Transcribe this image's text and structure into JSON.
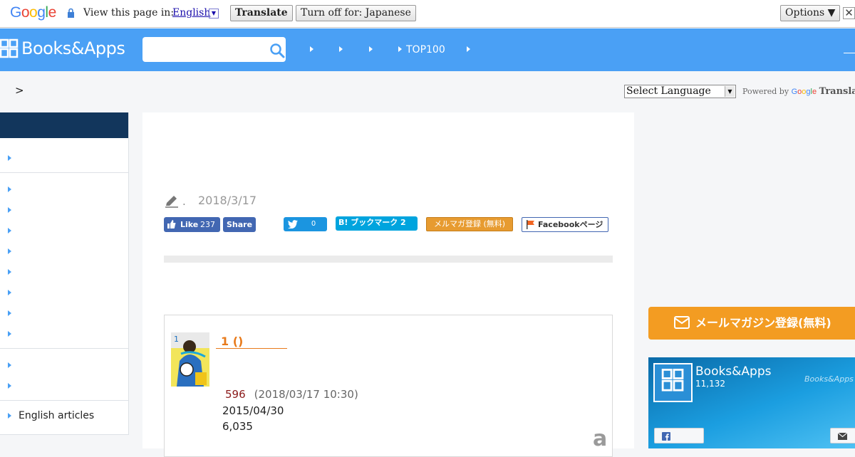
{
  "translate_bar": {
    "logo": "Google",
    "view_label": "View this page in:",
    "language": "English",
    "translate_btn": "Translate",
    "turn_off_btn": "Turn off for: Japanese",
    "options_btn": "Options ▼",
    "close": "✕"
  },
  "header": {
    "logo_text": "Books&Apps",
    "nav": [
      "",
      "",
      "",
      "TOP100",
      ""
    ]
  },
  "breadcrumb": ">",
  "language_select": {
    "selected": "Select Language",
    "powered_by": "Powered by",
    "google": "Google",
    "translate": "Translate"
  },
  "sidebar": {
    "items": [
      "",
      "",
      "",
      "",
      "",
      "",
      "",
      "",
      "",
      "",
      "",
      "English articles"
    ]
  },
  "article": {
    "author": ".",
    "date": "2018/3/17",
    "share": {
      "fb_like": "Like",
      "fb_like_count": "237",
      "fb_share": "Share",
      "tweet_count": "0",
      "hatena": "B! ブックマーク 2",
      "mailmag": "メルマガ登録 (無料)",
      "fb_page": "Facebookページ"
    }
  },
  "book": {
    "title": "1 ()",
    "rank": "596",
    "rank_time": "(2018/03/17 10:30)",
    "release_date": "2015/04/30",
    "price": "6,035"
  },
  "right": {
    "mail_banner": "メールマガジン登録(無料)",
    "fb_widget": {
      "name": "Books&Apps",
      "likes": "11,132",
      "watermark": "Books&Apps"
    }
  },
  "colors": {
    "header": "#4aa0f5",
    "sidebar_head": "#12365c",
    "orange": "#f39c22",
    "facebook": "#4267b2"
  }
}
